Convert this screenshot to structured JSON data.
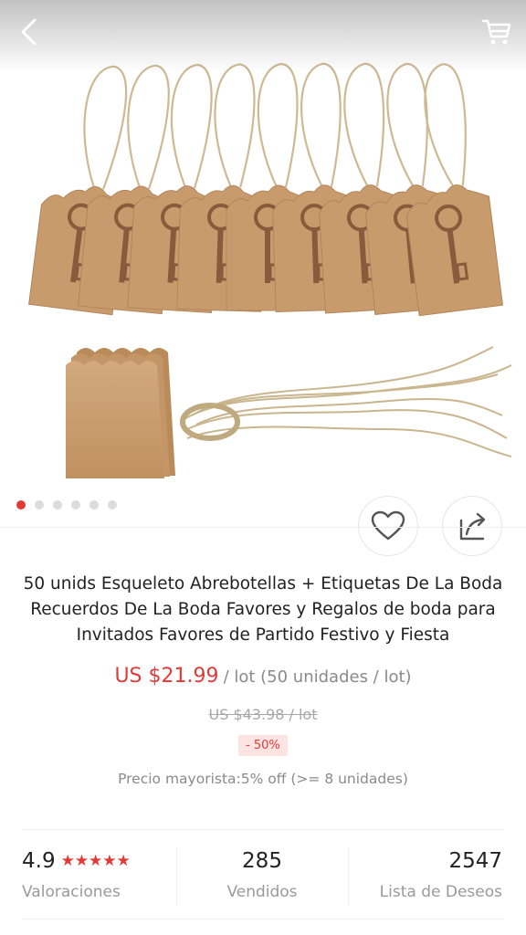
{
  "product": {
    "title": "50 unids Esqueleto Abrebotellas + Etiquetas De La Boda Recuerdos De La Boda Favores y Regalos de boda para Invitados Favores de Partido Festivo y Fiesta",
    "price": "US $21.99",
    "price_unit": "/ lot (50 unidades / lot)",
    "old_price": "US $43.98  / lot",
    "discount": "- 50%",
    "wholesale": "Precio mayorista:5% off (>= 8 unidades)"
  },
  "gallery": {
    "image_count": 6,
    "active_index": 0
  },
  "stats": {
    "rating_value": "4.9",
    "rating_stars": "★★★★★",
    "rating_label": "Valoraciones",
    "sold_value": "285",
    "sold_label": "Vendidos",
    "wishlist_value": "2547",
    "wishlist_label": "Lista de Deseos"
  },
  "icons": {
    "back": "chevron-left-icon",
    "cart": "cart-icon",
    "favorite": "heart-icon",
    "share": "share-icon"
  },
  "colors": {
    "accent": "#e53935",
    "kraft": "#c89b6d",
    "key": "#8a5a3c"
  }
}
